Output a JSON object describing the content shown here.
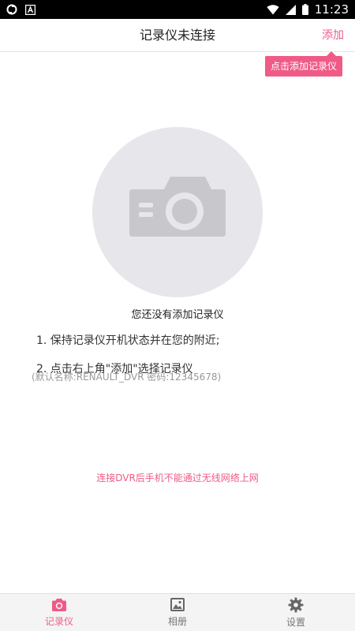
{
  "status_bar": {
    "time": "11:23",
    "icons": [
      "sync-icon",
      "app-a-icon",
      "wifi-icon",
      "signal-icon",
      "battery-icon"
    ]
  },
  "header": {
    "title": "记录仪未连接",
    "add_label": "添加"
  },
  "tooltip": {
    "text": "点击添加记录仪"
  },
  "empty_state": {
    "icon": "camera-icon",
    "title": "您还没有添加记录仪",
    "steps": [
      "1. 保持记录仪开机状态并在您的附近;",
      "2. 点击右上角\"添加\"选择记录仪"
    ],
    "hint": "(默认名称:RENAULT_DVR 密码:12345678)"
  },
  "warning": {
    "text": "连接DVR后手机不能通过无线网络上网"
  },
  "bottom_nav": {
    "items": [
      {
        "label": "记录仪",
        "icon": "camera-icon",
        "active": true
      },
      {
        "label": "相册",
        "icon": "photo-album-icon",
        "active": false
      },
      {
        "label": "设置",
        "icon": "gear-icon",
        "active": false
      }
    ]
  },
  "colors": {
    "accent": "#ef5b86",
    "placeholder_bg": "#e7e6ea",
    "placeholder_icon": "#c8c7cc"
  }
}
